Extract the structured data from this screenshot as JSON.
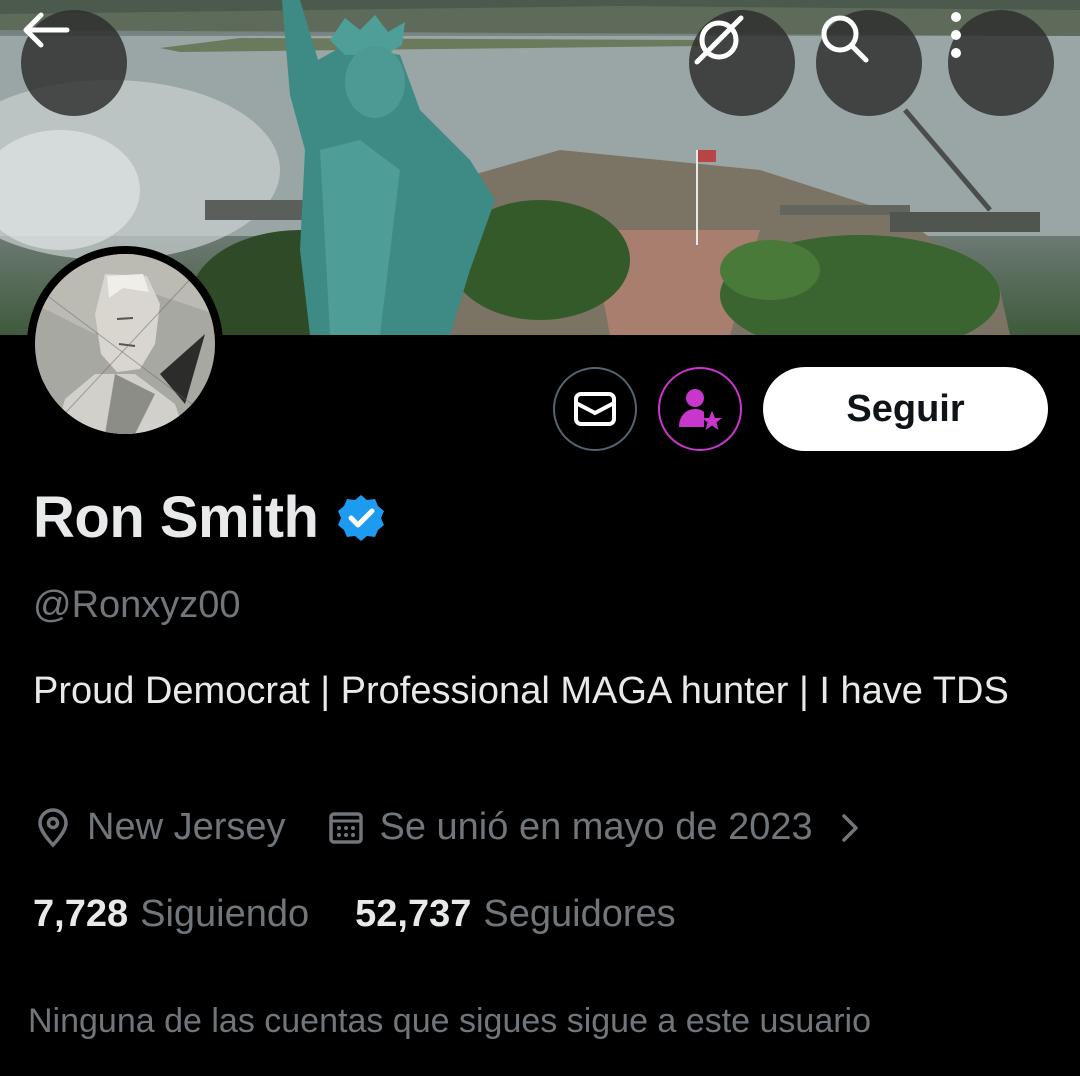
{
  "header": {
    "back_icon": "arrow-left-icon",
    "grok_icon": "grok-icon",
    "search_icon": "search-icon",
    "more_icon": "more-vertical-icon"
  },
  "profile": {
    "display_name": "Ron Smith",
    "verified": true,
    "handle": "@Ronxyz00",
    "bio": "Proud Democrat | Professional MAGA hunter | I have TDS",
    "location": "New Jersey",
    "joined": "Se unió en mayo de 2023",
    "following_count": "7,728",
    "following_label": "Siguiendo",
    "followers_count": "52,737",
    "followers_label": "Seguidores",
    "mutuals_note": "Ninguna de las cuentas que sigues sigue a este usuario"
  },
  "actions": {
    "message_icon": "envelope-icon",
    "subscribe_icon": "person-star-icon",
    "follow_label": "Seguir"
  },
  "colors": {
    "background": "#000000",
    "primary_text": "#e7e9ea",
    "secondary_text": "#71767b",
    "verified_blue": "#1d9bf0",
    "subscribe_purple": "#c936cc"
  }
}
